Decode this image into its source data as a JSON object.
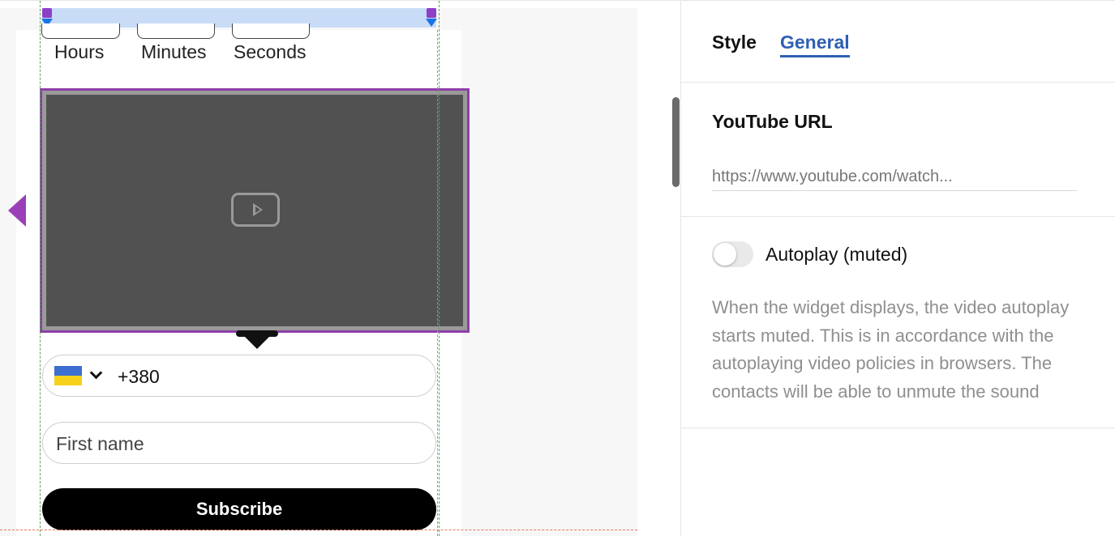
{
  "canvas": {
    "countdown": {
      "hours_label": "Hours",
      "minutes_label": "Minutes",
      "seconds_label": "Seconds"
    },
    "video_icon": "play-icon",
    "phone": {
      "country_flag": "ukraine-flag-icon",
      "dial_code": "+380"
    },
    "first_name_placeholder": "First name",
    "subscribe_label": "Subscribe"
  },
  "panel": {
    "tabs": [
      {
        "label": "Style",
        "active": false
      },
      {
        "label": "General",
        "active": true
      }
    ],
    "youtube_url": {
      "title": "YouTube URL",
      "placeholder": "https://www.youtube.com/watch...",
      "value": ""
    },
    "autoplay": {
      "label": "Autoplay (muted)",
      "enabled": false,
      "help": "When the widget displays, the video autoplay starts muted. This is in accordance with the autoplaying video policies in browsers. The contacts will be able to unmute the sound"
    }
  },
  "colors": {
    "selection": "#8e3fa8",
    "accent_blue": "#2f5fb3",
    "button_bg": "#000000"
  }
}
